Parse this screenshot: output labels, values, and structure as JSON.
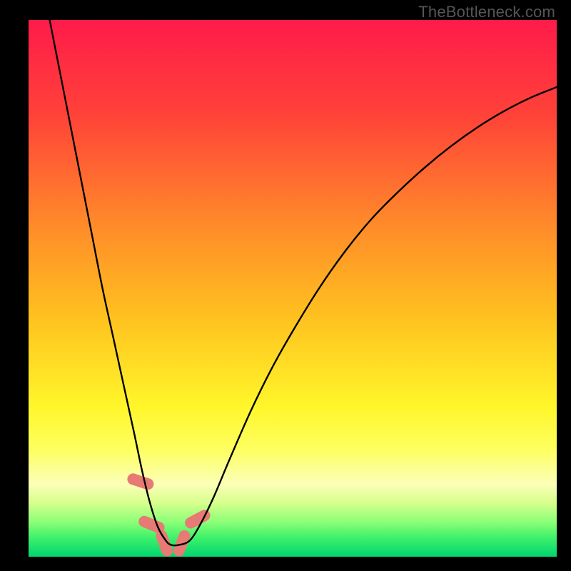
{
  "watermark": "TheBottleneck.com",
  "chart_data": {
    "type": "line",
    "title": "",
    "xlabel": "",
    "ylabel": "",
    "xlim": [
      0,
      100
    ],
    "ylim": [
      0,
      100
    ],
    "background_gradient": {
      "stops": [
        {
          "offset": 0.0,
          "color": "#ff1b4a"
        },
        {
          "offset": 0.18,
          "color": "#ff4338"
        },
        {
          "offset": 0.38,
          "color": "#ff8a2a"
        },
        {
          "offset": 0.55,
          "color": "#ffc01f"
        },
        {
          "offset": 0.72,
          "color": "#fff62a"
        },
        {
          "offset": 0.8,
          "color": "#fdff60"
        },
        {
          "offset": 0.865,
          "color": "#fcffb8"
        },
        {
          "offset": 0.9,
          "color": "#d6ff8c"
        },
        {
          "offset": 0.935,
          "color": "#8cff78"
        },
        {
          "offset": 0.965,
          "color": "#3ef06a"
        },
        {
          "offset": 1.0,
          "color": "#00d670"
        }
      ]
    },
    "series": [
      {
        "name": "bottleneck-curve",
        "color": "#000000",
        "x": [
          4,
          6,
          8,
          10,
          12,
          14,
          16,
          18,
          20,
          21.5,
          23,
          24.5,
          26,
          27,
          28.5,
          30.5,
          32.5,
          35,
          38,
          42,
          46,
          50,
          55,
          60,
          65,
          70,
          75,
          80,
          85,
          90,
          95,
          100
        ],
        "y": [
          100,
          90,
          80,
          70,
          60,
          50,
          41,
          32,
          23,
          16,
          10,
          5.5,
          3,
          2.2,
          2.2,
          3,
          6,
          11,
          18,
          27,
          35,
          42,
          50,
          57,
          63,
          68,
          72.5,
          76.5,
          80,
          83,
          85.5,
          87.5
        ]
      }
    ],
    "markers": {
      "name": "highlight-markers",
      "color": "#e77a74",
      "points": [
        {
          "x": 21.2,
          "y": 14.0,
          "angle": -72
        },
        {
          "x": 23.3,
          "y": 6.0,
          "angle": -68
        },
        {
          "x": 25.7,
          "y": 2.5,
          "angle": -20
        },
        {
          "x": 29.0,
          "y": 2.5,
          "angle": 20
        },
        {
          "x": 32.0,
          "y": 7.0,
          "angle": 62
        }
      ]
    }
  }
}
